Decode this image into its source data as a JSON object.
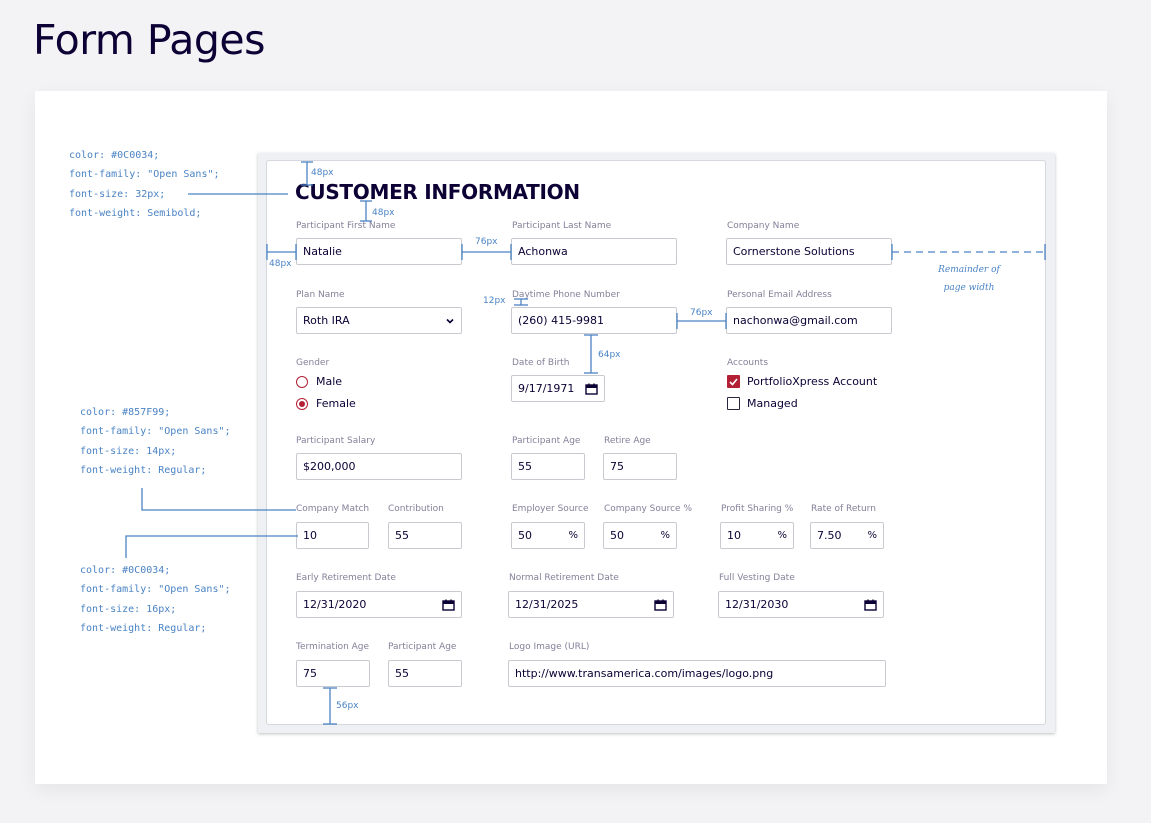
{
  "page_title": "Form Pages",
  "specs": {
    "title_spec": [
      "color: #0C0034;",
      "font-family: \"Open Sans\";",
      "font-size: 32px;",
      "font-weight: Semibold;"
    ],
    "label_spec": [
      "color: #857F99;",
      "font-family: \"Open Sans\";",
      "font-size: 14px;",
      "font-weight: Regular;"
    ],
    "input_spec": [
      "color: #0C0034;",
      "font-family: \"Open Sans\";",
      "font-size: 16px;",
      "font-weight: Regular;"
    ]
  },
  "dimensions": {
    "top_padding": "48px",
    "title_gap": "48px",
    "left_padding": "48px",
    "column_gap": "76px",
    "label_gap": "12px",
    "row_gap": "64px",
    "column_gap_2": "76px",
    "bottom_padding": "56px"
  },
  "remainder_note": [
    "Remainder of",
    "page width"
  ],
  "form": {
    "title": "CUSTOMER INFORMATION",
    "first_name": {
      "label": "Participant First Name",
      "value": "Natalie"
    },
    "last_name": {
      "label": "Participant Last Name",
      "value": "Achonwa"
    },
    "company_name": {
      "label": "Company Name",
      "value": "Cornerstone Solutions"
    },
    "plan_name": {
      "label": "Plan Name",
      "value": "Roth IRA"
    },
    "daytime_phone": {
      "label": "Daytime Phone Number",
      "value": "(260) 415-9981"
    },
    "personal_email": {
      "label": "Personal Email Address",
      "value": "nachonwa@gmail.com"
    },
    "gender": {
      "label": "Gender",
      "options": [
        "Male",
        "Female"
      ],
      "selected": "Female"
    },
    "date_of_birth": {
      "label": "Date of Birth",
      "value": "9/17/1971"
    },
    "accounts": {
      "label": "Accounts",
      "options": [
        {
          "label": "PortfolioXpress Account",
          "checked": true
        },
        {
          "label": "Managed",
          "checked": false
        }
      ]
    },
    "participant_salary": {
      "label": "Participant Salary",
      "value": "$200,000"
    },
    "participant_age": {
      "label": "Participant Age",
      "value": "55"
    },
    "retire_age": {
      "label": "Retire Age",
      "value": "75"
    },
    "company_match": {
      "label": "Company Match",
      "value": "10"
    },
    "contribution": {
      "label": "Contribution",
      "value": "55"
    },
    "employer_source": {
      "label": "Employer Source",
      "value": "50",
      "suffix": "%"
    },
    "company_source_pct": {
      "label": "Company Source %",
      "value": "50",
      "suffix": "%"
    },
    "profit_sharing_pct": {
      "label": "Profit Sharing %",
      "value": "10",
      "suffix": "%"
    },
    "rate_of_return": {
      "label": "Rate of Return",
      "value": "7.50",
      "suffix": "%"
    },
    "early_retirement_date": {
      "label": "Early Retirement Date",
      "value": "12/31/2020"
    },
    "normal_retirement_date": {
      "label": "Normal Retirement Date",
      "value": "12/31/2025"
    },
    "full_vesting_date": {
      "label": "Full Vesting Date",
      "value": "12/31/2030"
    },
    "termination_age": {
      "label": "Termination Age",
      "value": "75"
    },
    "participant_age_2": {
      "label": "Participant Age",
      "value": "55"
    },
    "logo_image_url": {
      "label": "Logo Image (URL)",
      "value": "http://www.transamerica.com/images/logo.png"
    }
  },
  "colors": {
    "title": "#0C0034",
    "label": "#857F99",
    "annotation": "#4A83C4",
    "accent": "#B32036"
  },
  "icons": [
    "chevron-down-icon",
    "calendar-icon",
    "checkmark-icon"
  ]
}
